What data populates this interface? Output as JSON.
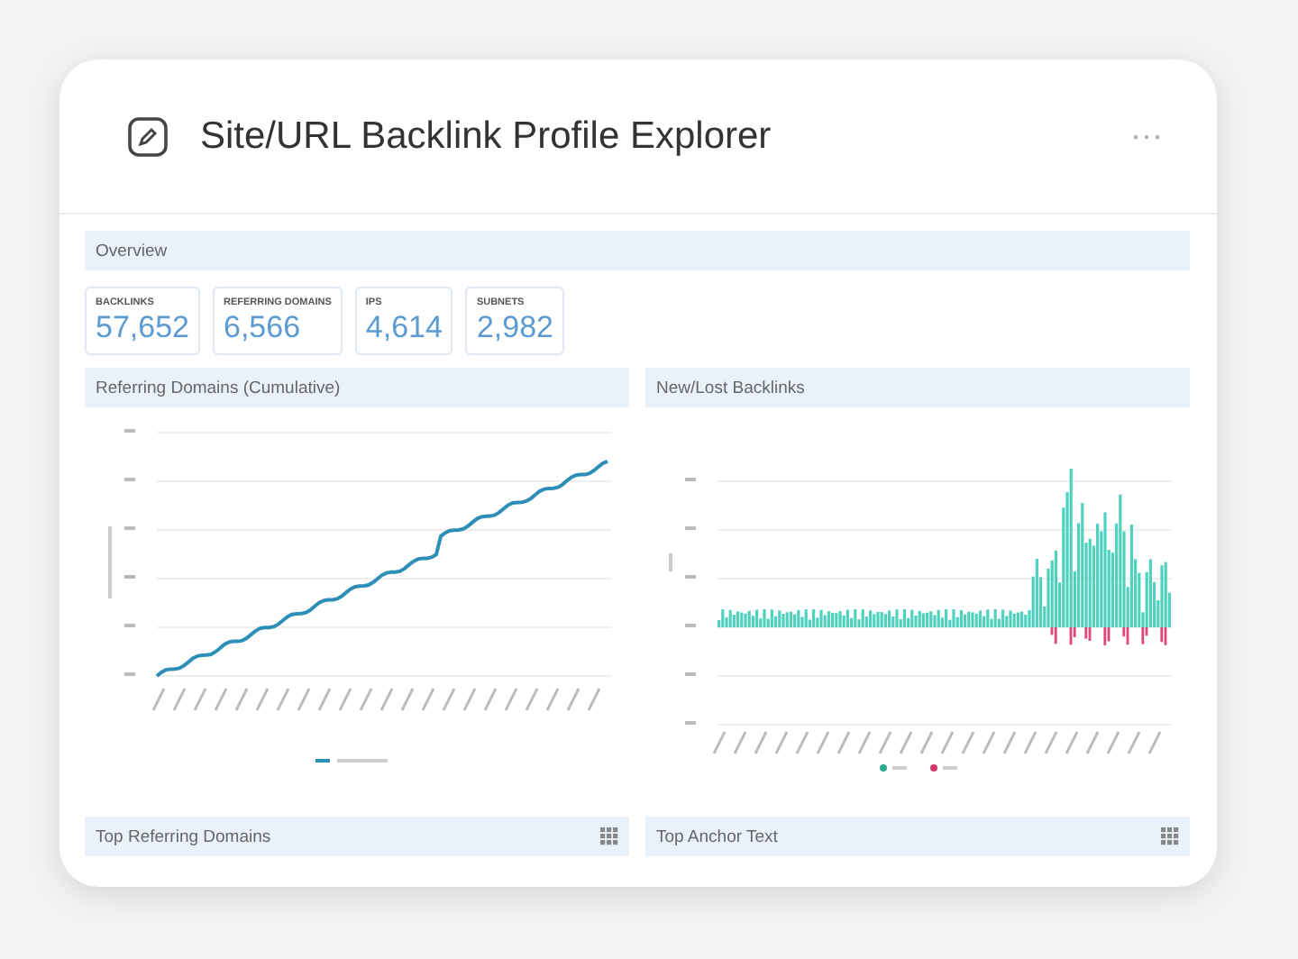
{
  "header": {
    "title": "Site/URL Backlink Profile Explorer",
    "menu": "···"
  },
  "overview": {
    "title": "Overview",
    "stats": [
      {
        "label": "BACKLINKS",
        "value": "57,652"
      },
      {
        "label": "REFERRING DOMAINS",
        "value": "6,566"
      },
      {
        "label": "IPS",
        "value": "4,614"
      },
      {
        "label": "SUBNETS",
        "value": "2,982"
      }
    ]
  },
  "panels": [
    {
      "title": "Referring Domains (Cumulative)",
      "kind": "line"
    },
    {
      "title": "New/Lost Backlinks",
      "kind": "bars"
    }
  ],
  "bottom_panels": [
    {
      "title": "Top Referring Domains"
    },
    {
      "title": "Top Anchor Text"
    }
  ]
}
